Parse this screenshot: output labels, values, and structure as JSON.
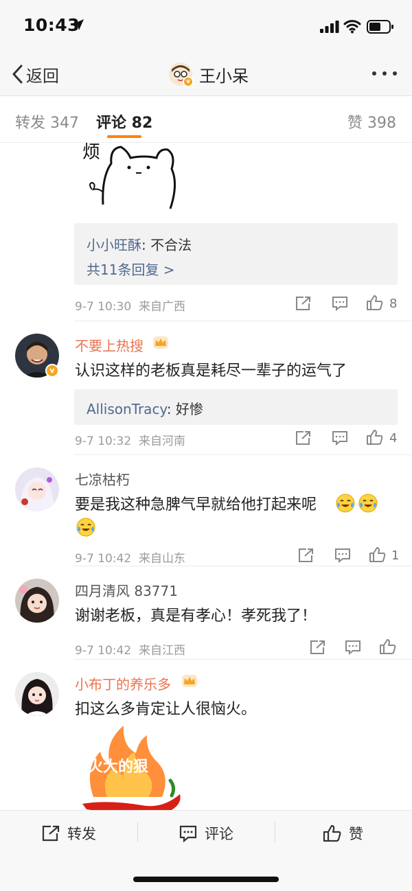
{
  "status_bar": {
    "time": "10:43"
  },
  "nav": {
    "back_label": "返回",
    "title": "王小呆"
  },
  "tabs": {
    "repost": "转发 347",
    "comments": "评论 82",
    "likes": "赞 398"
  },
  "comments": [
    {
      "time": "9-7 10:30",
      "location": "来自广西",
      "like_count": "8",
      "reply_user": "小小旺酥",
      "reply_text": ": 不合法",
      "reply_more": "共11条回复 >"
    },
    {
      "username": "不要上热搜",
      "text": "认识这样的老板真是耗尽一辈子的运气了",
      "reply_user": "AllisonTracy",
      "reply_text": ": 好惨",
      "time": "9-7 10:32",
      "location": "来自河南",
      "like_count": "4"
    },
    {
      "username": "七凉枯朽",
      "text": "要是我这种急脾气早就给他打起来呢",
      "time": "9-7 10:42",
      "location": "来自山东",
      "like_count": "1"
    },
    {
      "username": "四月清风 83771",
      "text": "谢谢老板，真是有孝心！孝死我了！",
      "time": "9-7 10:42",
      "location": "来自江西"
    },
    {
      "username": "小布丁的养乐多",
      "text": "扣这么多肯定让人很恼火。",
      "sticker_text": "火大的狠"
    }
  ],
  "bottom_bar": {
    "repost": "转发",
    "comment": "评论",
    "like": "赞"
  },
  "colors": {
    "accent": "#ff8200",
    "link": "#50698f",
    "vip_name": "#eb7350"
  },
  "icons": [
    "location-arrow-icon",
    "signal-icon",
    "wifi-icon",
    "battery-icon",
    "chevron-left-icon",
    "more-icon",
    "share-icon",
    "comment-icon",
    "thumb-up-icon",
    "crown-icon",
    "laugh-cry-emoji"
  ]
}
